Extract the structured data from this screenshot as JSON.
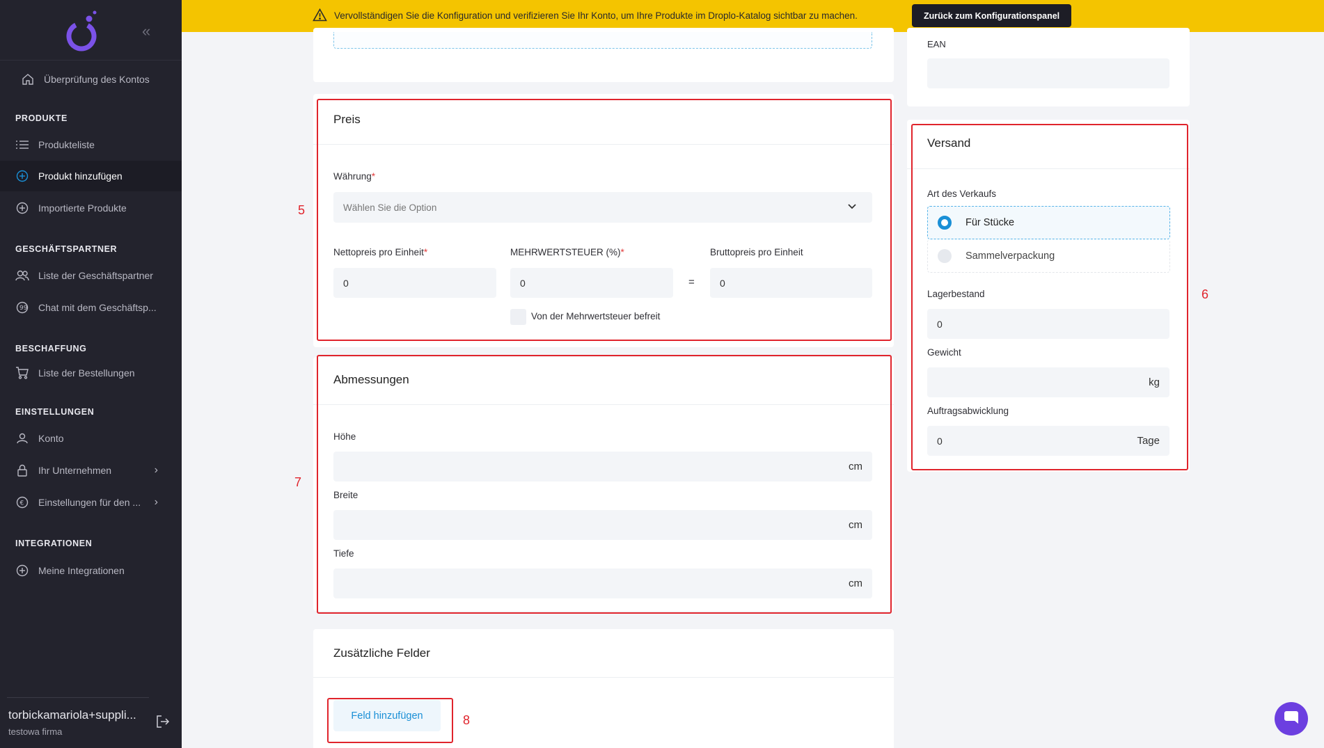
{
  "sidebar": {
    "account_check": "Überprüfung des Kontos",
    "sections": {
      "products": "PRODUKTE",
      "partners": "GESCHÄFTSPARTNER",
      "procurement": "BESCHAFFUNG",
      "settings": "EINSTELLUNGEN",
      "integrations": "INTEGRATIONEN"
    },
    "items": {
      "product_list": "Produkteliste",
      "add_product": "Produkt hinzufügen",
      "imported_products": "Importierte Produkte",
      "partner_list": "Liste der Geschäftspartner",
      "partner_chat": "Chat mit dem Geschäftsp...",
      "orders_list": "Liste der Bestellungen",
      "account": "Konto",
      "your_company": "Ihr Unternehmen",
      "settings_for": "Einstellungen für den ...",
      "my_integrations": "Meine Integrationen"
    },
    "user": {
      "name": "torbickamariola+suppli...",
      "company": "testowa firma"
    }
  },
  "banner": {
    "text": "Vervollständigen Sie die Konfiguration und verifizieren Sie Ihr Konto, um Ihre Produkte im Droplo-Katalog sichtbar zu machen.",
    "button": "Zurück zum Konfigurationspanel"
  },
  "ean": {
    "label": "EAN",
    "value": ""
  },
  "price": {
    "title": "Preis",
    "currency_label": "Währung",
    "currency_placeholder": "Wählen Sie die Option",
    "net_label": "Nettopreis pro Einheit",
    "net_value": "0",
    "vat_label": "MEHRWERTSTEUER (%)",
    "vat_value": "0",
    "equals": "=",
    "gross_label": "Bruttopreis pro Einheit",
    "gross_value": "0",
    "vat_exempt_label": "Von der Mehrwertsteuer befreit"
  },
  "dimensions": {
    "title": "Abmessungen",
    "height_label": "Höhe",
    "width_label": "Breite",
    "depth_label": "Tiefe",
    "unit": "cm"
  },
  "additional": {
    "title": "Zusätzliche Felder",
    "add_button": "Feld hinzufügen"
  },
  "shipping": {
    "title": "Versand",
    "sale_type_label": "Art des Verkaufs",
    "option_pieces": "Für Stücke",
    "option_bulk": "Sammelverpackung",
    "stock_label": "Lagerbestand",
    "stock_value": "0",
    "weight_label": "Gewicht",
    "weight_unit": "kg",
    "handling_label": "Auftragsabwicklung",
    "handling_value": "0",
    "handling_unit": "Tage"
  },
  "annotations": {
    "n5": "5",
    "n6": "6",
    "n7": "7",
    "n8": "8"
  },
  "colors": {
    "sidebar_bg": "#23232d",
    "banner_bg": "#f4c400",
    "accent": "#1a8fd6",
    "annotation_red": "#e0242c",
    "chat_purple": "#6c3fe0"
  }
}
